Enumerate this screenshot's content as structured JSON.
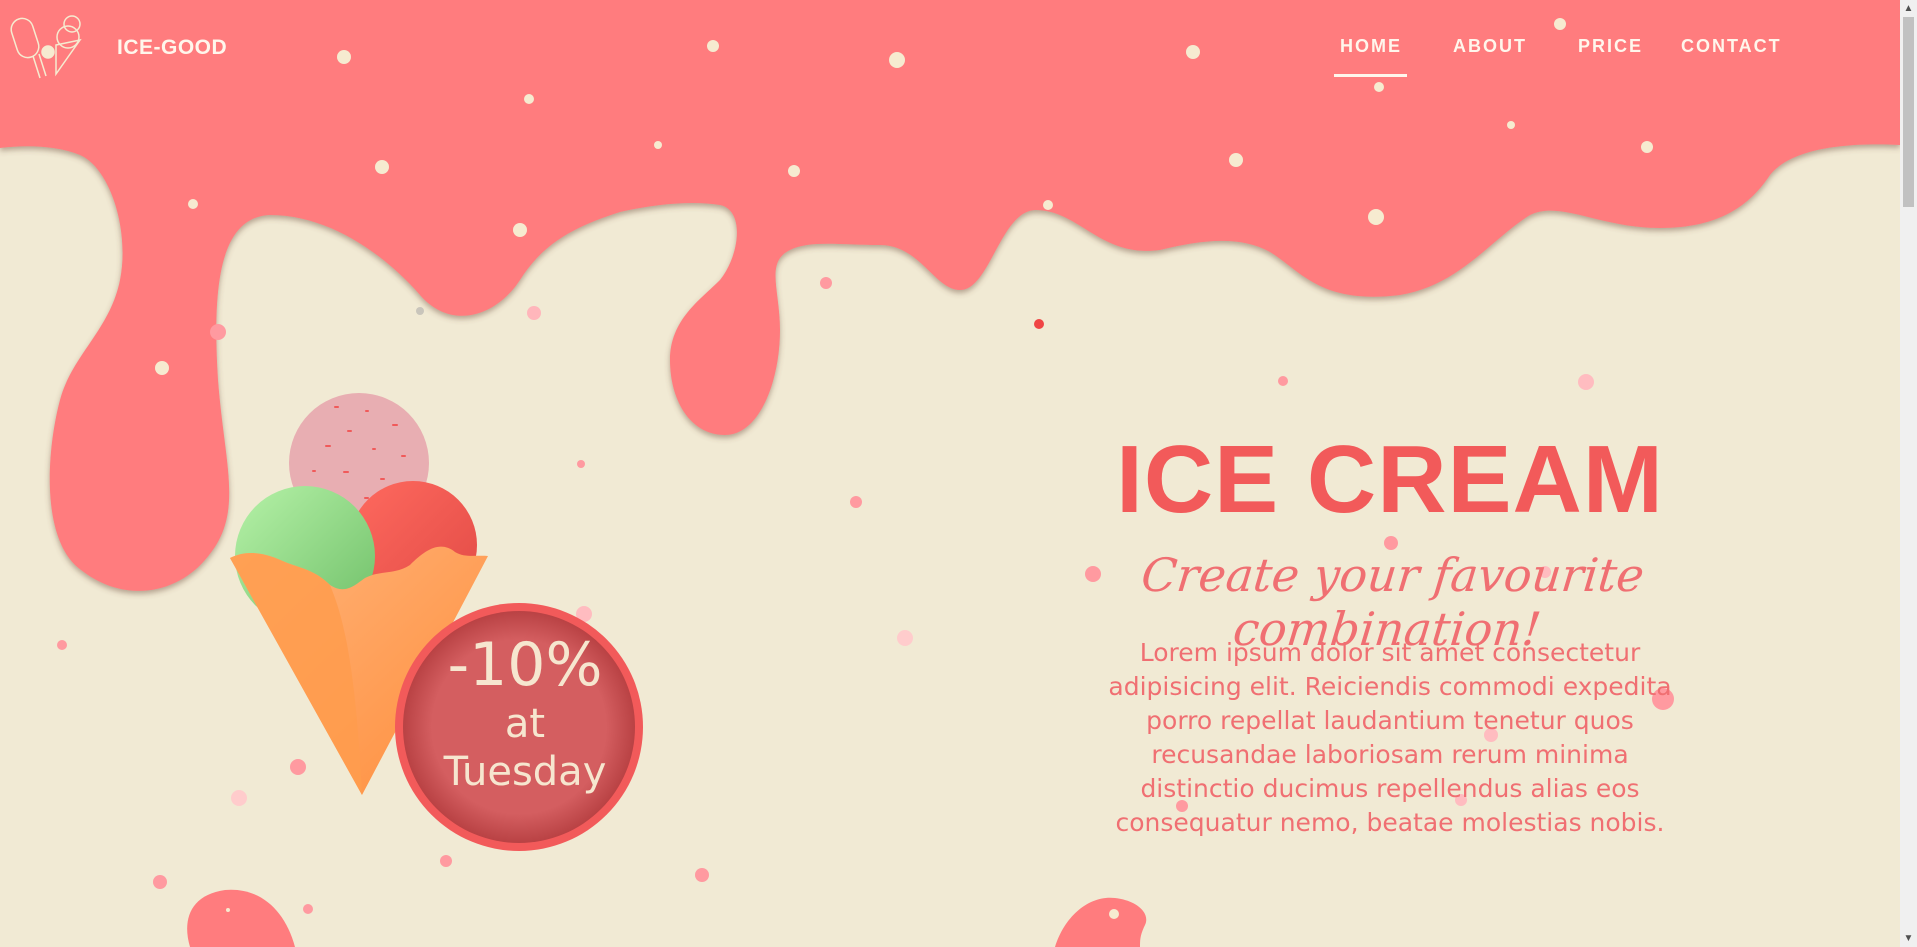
{
  "brand": {
    "name": "ICE-GOOD"
  },
  "nav": {
    "items": [
      {
        "label": "HOME",
        "active": true
      },
      {
        "label": "ABOUT"
      },
      {
        "label": "PRICE"
      },
      {
        "label": "CONTACT"
      }
    ]
  },
  "hero": {
    "title": "ICE CREAM",
    "subtitle": "Create your favourite combination!",
    "text": "Lorem ipsum dolor sit amet consectetur adipisicing elit. Reiciendis commodi expedita porro repellat laudantium tenetur quos recusandae laboriosam rerum minima distinctio ducimus repellendus alias eos consequatur nemo, beatae molestias nobis."
  },
  "badge": {
    "discount": "-10%",
    "line1": "at",
    "line2": "Tuesday"
  },
  "colors": {
    "background": "#f1ead4",
    "drip": "#ff7c7e",
    "accent": "#f25a5a",
    "badge": "#d45e60",
    "nav_text": "#fff6ec"
  },
  "icons": [
    "ice-cream-logo-icon",
    "ice-cream-cone-icon"
  ]
}
